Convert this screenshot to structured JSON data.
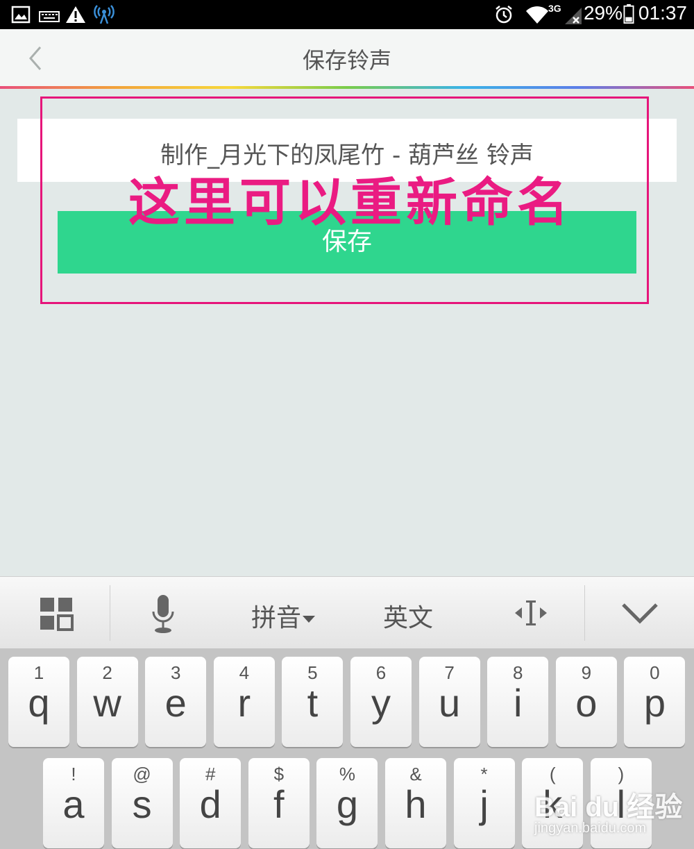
{
  "status_bar": {
    "icons": [
      "gallery-icon",
      "keyboard-icon",
      "warning-icon",
      "hotspot-icon",
      "alarm-icon",
      "wifi-icon",
      "signal-3g-icon",
      "battery-icon"
    ],
    "network": "3G",
    "battery": "29%",
    "time": "01:37"
  },
  "header": {
    "title": "保存铃声"
  },
  "main": {
    "ringtone_name": "制作_月光下的凤尾竹 - 葫芦丝 铃声",
    "save_label": "保存",
    "annotation": "这里可以重新命名"
  },
  "keyboard": {
    "toolbar": {
      "pinyin_label": "拼音",
      "english_label": "英文"
    },
    "row1": [
      {
        "hint": "1",
        "key": "q"
      },
      {
        "hint": "2",
        "key": "w"
      },
      {
        "hint": "3",
        "key": "e"
      },
      {
        "hint": "4",
        "key": "r"
      },
      {
        "hint": "5",
        "key": "t"
      },
      {
        "hint": "6",
        "key": "y"
      },
      {
        "hint": "7",
        "key": "u"
      },
      {
        "hint": "8",
        "key": "i"
      },
      {
        "hint": "9",
        "key": "o"
      },
      {
        "hint": "0",
        "key": "p"
      }
    ],
    "row2": [
      {
        "hint": "!",
        "key": "a"
      },
      {
        "hint": "@",
        "key": "s"
      },
      {
        "hint": "#",
        "key": "d"
      },
      {
        "hint": "$",
        "key": "f"
      },
      {
        "hint": "%",
        "key": "g"
      },
      {
        "hint": "&",
        "key": "h"
      },
      {
        "hint": "*",
        "key": "j"
      },
      {
        "hint": "(",
        "key": "k"
      },
      {
        "hint": ")",
        "key": "l"
      }
    ]
  },
  "watermark": {
    "main": "Bai du 经验",
    "sub": "jingyan.baidu.com"
  },
  "colors": {
    "accent_green": "#2fd68e",
    "annotation_pink": "#e6157a",
    "background": "#e2e9e8"
  }
}
